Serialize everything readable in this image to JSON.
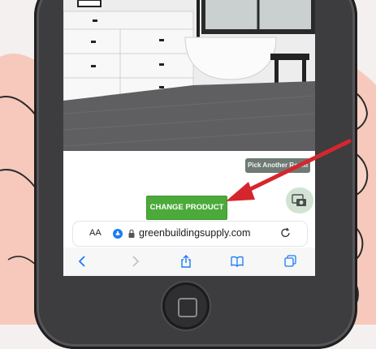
{
  "overlay": {
    "pick_another_label": "Pick Another Room",
    "change_product_label": "CHANGE PRODUCT"
  },
  "browser": {
    "text_size_label": "AA",
    "url": "greenbuildingsupply.com"
  },
  "icons": {
    "annotation": "red-arrow",
    "photo": "camera-photos-icon",
    "back": "chevron-left-icon",
    "forward": "chevron-right-icon",
    "share": "share-icon",
    "bookmarks": "book-icon",
    "tabs": "tabs-icon",
    "reload": "reload-icon",
    "lock": "lock-icon",
    "home": "home-button"
  },
  "colors": {
    "accent_green": "#4caa3a",
    "safari_blue": "#1a7cf5",
    "annotation_red": "#d6262d",
    "floor": "#5f5f62"
  }
}
